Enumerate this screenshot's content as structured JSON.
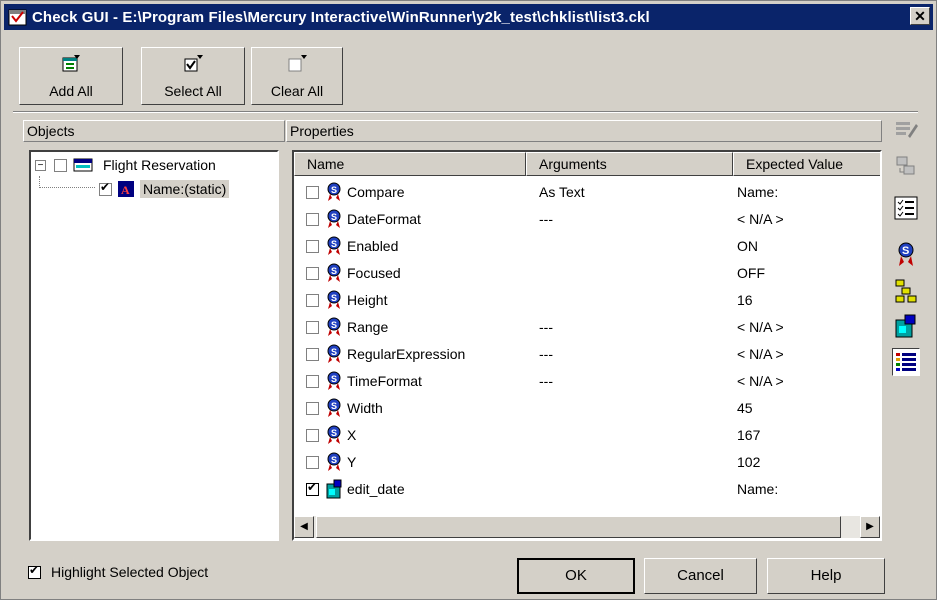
{
  "window": {
    "title": "Check GUI - E:\\Program Files\\Mercury Interactive\\WinRunner\\y2k_test\\chklist\\list3.ckl",
    "close_label": "✕"
  },
  "toolbar": {
    "add_all": {
      "label": "Add All",
      "icon": "add-all-icon"
    },
    "select_all": {
      "label": "Select All",
      "icon": "select-all-icon"
    },
    "clear_all": {
      "label": "Clear All",
      "icon": "clear-all-icon"
    }
  },
  "objects": {
    "title": "Objects",
    "tree": [
      {
        "label": "Flight Reservation",
        "checked": false,
        "icon": "window-icon",
        "expand": "−"
      },
      {
        "label": "Name:(static)",
        "checked": true,
        "icon": "static-text-icon",
        "selected": true
      }
    ]
  },
  "properties": {
    "title": "Properties",
    "columns": [
      "Name",
      "Arguments",
      "Expected Value"
    ],
    "rows": [
      {
        "name": "Compare",
        "args": "As Text",
        "value": "Name:",
        "checked": false,
        "icon": "property-icon"
      },
      {
        "name": "DateFormat",
        "args": "---",
        "value": "< N/A >",
        "checked": false,
        "icon": "property-icon"
      },
      {
        "name": "Enabled",
        "args": "",
        "value": "ON",
        "checked": false,
        "icon": "property-icon"
      },
      {
        "name": "Focused",
        "args": "",
        "value": "OFF",
        "checked": false,
        "icon": "property-icon"
      },
      {
        "name": "Height",
        "args": "",
        "value": "16",
        "checked": false,
        "icon": "property-icon"
      },
      {
        "name": "Range",
        "args": "---",
        "value": "< N/A >",
        "checked": false,
        "icon": "property-icon"
      },
      {
        "name": "RegularExpression",
        "args": "---",
        "value": "< N/A >",
        "checked": false,
        "icon": "property-icon"
      },
      {
        "name": "TimeFormat",
        "args": "---",
        "value": "< N/A >",
        "checked": false,
        "icon": "property-icon"
      },
      {
        "name": "Width",
        "args": "",
        "value": "45",
        "checked": false,
        "icon": "property-icon"
      },
      {
        "name": "X",
        "args": "",
        "value": "167",
        "checked": false,
        "icon": "property-icon"
      },
      {
        "name": "Y",
        "args": "",
        "value": "102",
        "checked": false,
        "icon": "property-icon"
      },
      {
        "name": "edit_date",
        "args": "",
        "value": "Name:",
        "checked": true,
        "icon": "edit-object-icon"
      }
    ]
  },
  "sidebar_icons": [
    "edit-expected-icon",
    "compare-icon",
    "checklist-icon",
    "property-ribbon-icon",
    "hierarchy-icon",
    "object-icon",
    "list-view-icon"
  ],
  "highlight": {
    "label": "Highlight Selected Object",
    "checked": true
  },
  "buttons": {
    "ok": "OK",
    "cancel": "Cancel",
    "help": "Help"
  }
}
